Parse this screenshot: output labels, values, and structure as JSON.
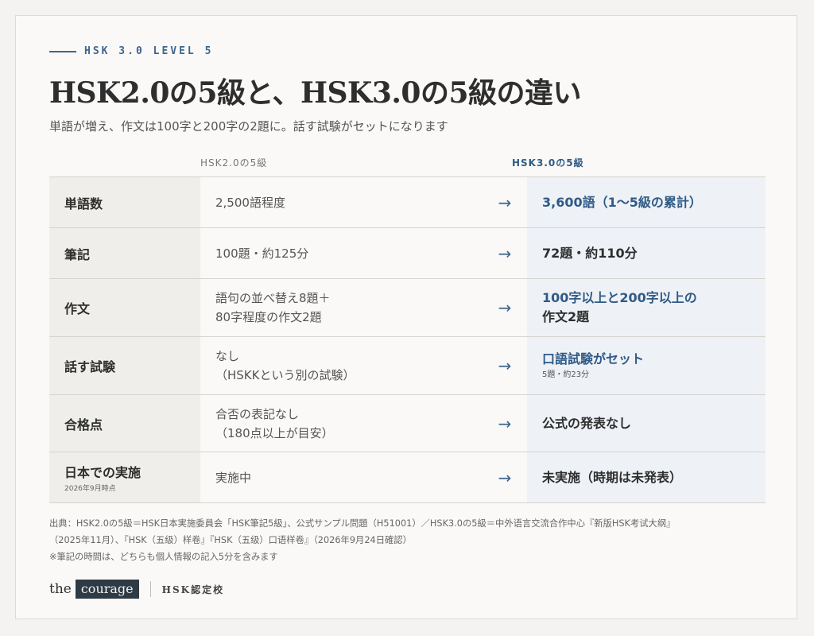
{
  "eyebrow": "HSK 3.0 LEVEL 5",
  "title": "HSK2.0の5級と、HSK3.0の5級の違い",
  "subtitle": "単語が増え、作文は100字と200字の2題に。話す試験がセットになります",
  "table": {
    "col_old": "HSK2.0の5級",
    "col_new": "HSK3.0の5級",
    "arrow": "→",
    "rows": [
      {
        "label": "単語数",
        "old": [
          "2,500語程度"
        ],
        "new_highlight": [
          "3,600語（1〜5級の累計）"
        ],
        "new_plain": []
      },
      {
        "label": "筆記",
        "old": [
          "100題・約125分"
        ],
        "new_highlight": [],
        "new_plain": [
          "72題・約110分"
        ]
      },
      {
        "label": "作文",
        "old": [
          "語句の並べ替え8題＋",
          "80字程度の作文2題"
        ],
        "new_highlight": [
          "100字以上と200字以上の"
        ],
        "new_plain": [
          "作文2題"
        ]
      },
      {
        "label": "話す試験",
        "old": [
          "なし",
          "（HSKKという別の試験）"
        ],
        "new_highlight": [
          "口語試験がセット"
        ],
        "new_plain": [],
        "new_sub": "5題・約23分"
      },
      {
        "label": "合格点",
        "old": [
          "合否の表記なし",
          "（180点以上が目安）"
        ],
        "new_highlight": [],
        "new_plain": [
          "公式の発表なし"
        ]
      },
      {
        "label": "日本での実施",
        "label_note": "2026年9月時点",
        "old": [
          "実施中"
        ],
        "new_highlight": [],
        "new_plain": [
          "未実施（時期は未発表）"
        ]
      }
    ]
  },
  "source_lines": [
    "出典：HSK2.0の5級＝HSK日本実施委員会「HSK筆記5級」、公式サンプル問題（H51001）／HSK3.0の5級＝中外语言交流合作中心『新版HSK考试大纲』",
    "（2025年11月）、『HSK（五级）样卷』『HSK（五级）口语样卷』（2026年9月24日確認）",
    "※筆記の時間は、どちらも個人情報の記入5分を含みます"
  ],
  "footer": {
    "logo_the": "the",
    "logo_courage": "courage",
    "cert": "HSK認定校"
  }
}
